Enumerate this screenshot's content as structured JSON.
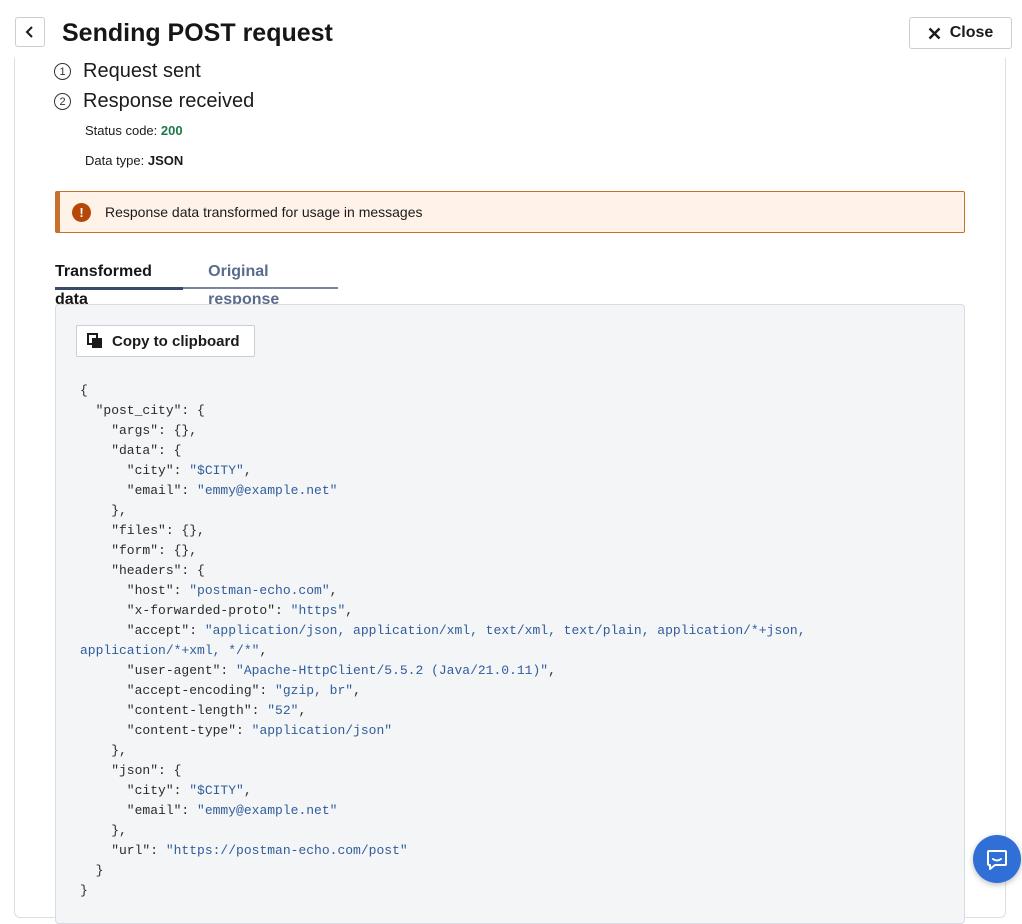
{
  "header": {
    "title": "Sending POST request",
    "close_label": "Close"
  },
  "steps": [
    {
      "number": "1",
      "label": "Request sent"
    },
    {
      "number": "2",
      "label": "Response received"
    }
  ],
  "response": {
    "status_label": "Status code:",
    "status_value": "200",
    "type_label": "Data type:",
    "type_value": "JSON"
  },
  "alert": {
    "text": "Response data transformed for usage in messages",
    "icon": "!"
  },
  "tabs": [
    {
      "label": "Transformed data",
      "active": true
    },
    {
      "label": "Original response",
      "active": false
    }
  ],
  "copy_label": "Copy to clipboard",
  "code_lines": [
    [
      [
        "p",
        "{"
      ]
    ],
    [
      [
        "p",
        "  \"post_city\": {"
      ]
    ],
    [
      [
        "p",
        "    \"args\": {},"
      ]
    ],
    [
      [
        "p",
        "    \"data\": {"
      ]
    ],
    [
      [
        "p",
        "      \"city\": "
      ],
      [
        "s",
        "\"$CITY\""
      ],
      [
        "p",
        ","
      ]
    ],
    [
      [
        "p",
        "      \"email\": "
      ],
      [
        "s",
        "\"emmy@example.net\""
      ]
    ],
    [
      [
        "p",
        "    },"
      ]
    ],
    [
      [
        "p",
        "    \"files\": {},"
      ]
    ],
    [
      [
        "p",
        "    \"form\": {},"
      ]
    ],
    [
      [
        "p",
        "    \"headers\": {"
      ]
    ],
    [
      [
        "p",
        "      \"host\": "
      ],
      [
        "s",
        "\"postman-echo.com\""
      ],
      [
        "p",
        ","
      ]
    ],
    [
      [
        "p",
        "      \"x-forwarded-proto\": "
      ],
      [
        "s",
        "\"https\""
      ],
      [
        "p",
        ","
      ]
    ],
    [
      [
        "p",
        "      \"accept\": "
      ],
      [
        "s",
        "\"application/json, application/xml, text/xml, text/plain, application/*+json,"
      ]
    ],
    [
      [
        "s",
        "application/*+xml, */*\""
      ],
      [
        "p",
        ","
      ]
    ],
    [
      [
        "p",
        "      \"user-agent\": "
      ],
      [
        "s",
        "\"Apache-HttpClient/5.5.2 (Java/21.0.11)\""
      ],
      [
        "p",
        ","
      ]
    ],
    [
      [
        "p",
        "      \"accept-encoding\": "
      ],
      [
        "s",
        "\"gzip, br\""
      ],
      [
        "p",
        ","
      ]
    ],
    [
      [
        "p",
        "      \"content-length\": "
      ],
      [
        "s",
        "\"52\""
      ],
      [
        "p",
        ","
      ]
    ],
    [
      [
        "p",
        "      \"content-type\": "
      ],
      [
        "s",
        "\"application/json\""
      ]
    ],
    [
      [
        "p",
        "    },"
      ]
    ],
    [
      [
        "p",
        "    \"json\": {"
      ]
    ],
    [
      [
        "p",
        "      \"city\": "
      ],
      [
        "s",
        "\"$CITY\""
      ],
      [
        "p",
        ","
      ]
    ],
    [
      [
        "p",
        "      \"email\": "
      ],
      [
        "s",
        "\"emmy@example.net\""
      ]
    ],
    [
      [
        "p",
        "    },"
      ]
    ],
    [
      [
        "p",
        "    \"url\": "
      ],
      [
        "s",
        "\"https://postman-echo.com/post\""
      ]
    ],
    [
      [
        "p",
        "  }"
      ]
    ],
    [
      [
        "p",
        "}"
      ]
    ]
  ]
}
